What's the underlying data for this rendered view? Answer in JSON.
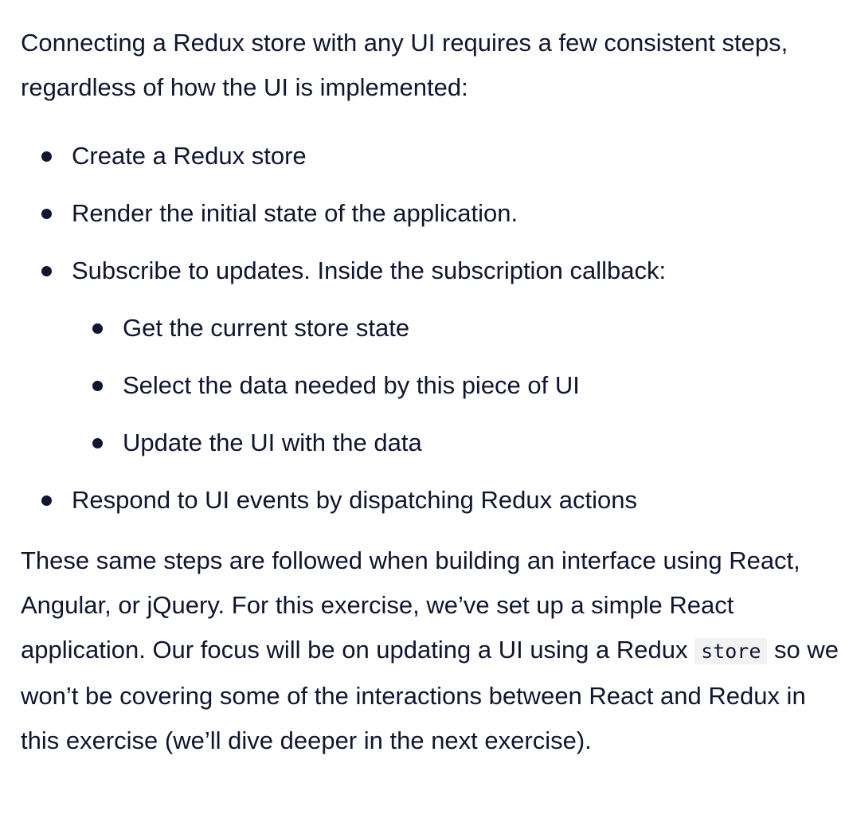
{
  "intro": "Connecting a Redux store with any UI requires a few consistent steps, regardless of how the UI is implemented:",
  "steps": [
    {
      "label": "Create a Redux store"
    },
    {
      "label": "Render the initial state of the application."
    },
    {
      "label": "Subscribe to updates. Inside the subscription callback:",
      "substeps": [
        "Get the current store state",
        "Select the data needed by this piece of UI",
        "Update the UI with the data"
      ]
    },
    {
      "label": "Respond to UI events by dispatching Redux actions"
    }
  ],
  "closing": {
    "before_code": "These same steps are followed when building an interface using React, Angular, or jQuery. For this exercise, we’ve set up a simple React application. Our focus will be on updating a UI using a Redux ",
    "code": "store",
    "after_code": " so we won’t be covering some of the interactions between React and Redux in this exercise (we’ll dive deeper in the next exercise)."
  }
}
